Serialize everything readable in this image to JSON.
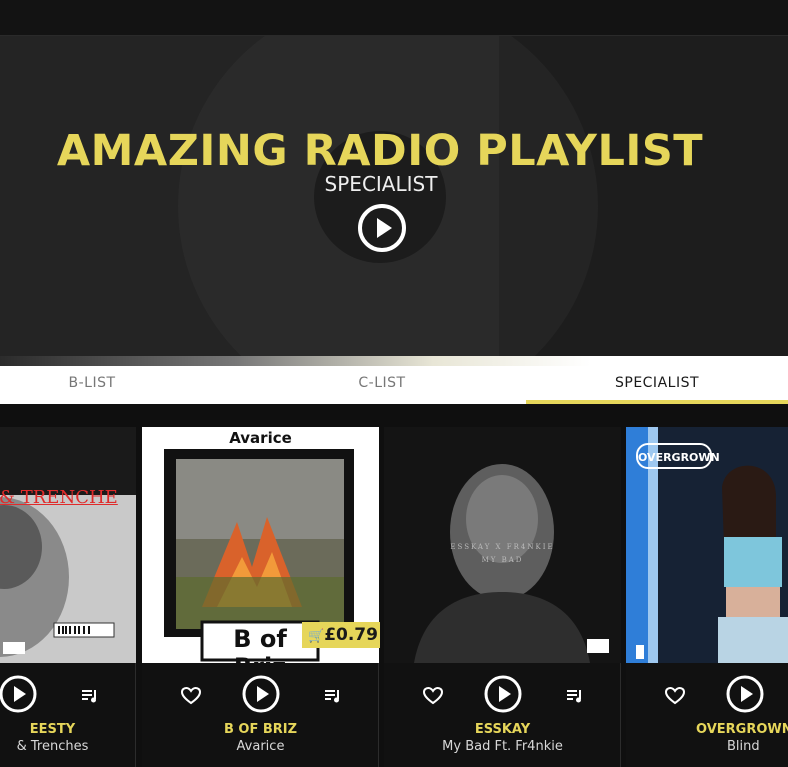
{
  "hero": {
    "title": "AMAZING RADIO PLAYLIST",
    "subtitle": "SPECIALIST",
    "accent": "#e6d65a"
  },
  "tabs": [
    {
      "label": "B-LIST",
      "active": false
    },
    {
      "label": "C-LIST",
      "active": false
    },
    {
      "label": "SPECIALIST",
      "active": true
    }
  ],
  "cards": [
    {
      "artist": "EESTY",
      "track": "& Trenches",
      "art_text": "& TRENCHE"
    },
    {
      "artist": "B OF BRIZ",
      "track": "Avarice",
      "art_title": "Avarice",
      "art_name": "B of Briz",
      "price": "£0.79"
    },
    {
      "artist": "ESSKAY",
      "track": "My Bad Ft. Fr4nkie",
      "art_line1": "ESSKAY X FR4NKIE",
      "art_line2": "MY BAD"
    },
    {
      "artist": "OVERGROWN",
      "track": "Blind",
      "art_logo": "OVERGROWN"
    }
  ],
  "icons": [
    "play-icon",
    "heart-icon",
    "queue-icon",
    "cart-icon",
    "parental-advisory-icon"
  ]
}
